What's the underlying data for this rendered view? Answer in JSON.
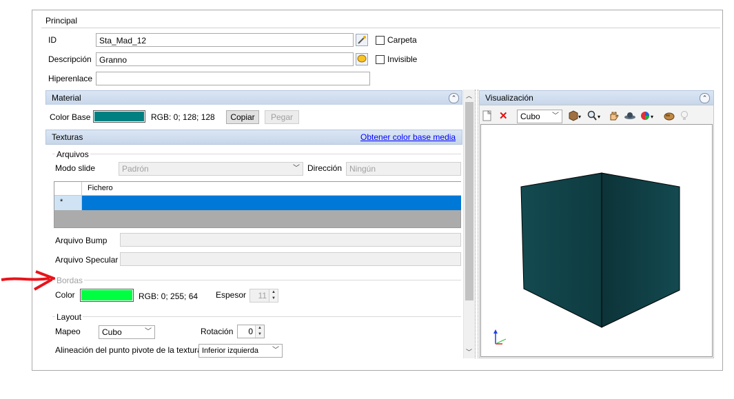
{
  "principal": {
    "header": "Principal"
  },
  "form": {
    "id_label": "ID",
    "id_value": "Sta_Mad_12",
    "desc_label": "Descripción",
    "desc_value": "Granno",
    "link_label": "Hiperenlace",
    "link_value": "",
    "carpeta_label": "Carpeta",
    "invisible_label": "Invisible"
  },
  "material": {
    "header": "Material",
    "color_base_label": "Color Base",
    "color_base_hex": "#008080",
    "rgb_text": "RGB: 0; 128; 128",
    "copy_label": "Copiar",
    "paste_label": "Pegar"
  },
  "texturas": {
    "header": "Texturas",
    "link": "Obtener color base media",
    "archivos_label": "Arquivos",
    "modo_label": "Modo slide",
    "modo_value": "Padrón",
    "direccion_label": "Dirección",
    "direccion_value": "Ningún",
    "grid_header": "Fichero",
    "grid_new_row_marker": "*",
    "bump_label": "Arquivo Bump",
    "specular_label": "Arquivo Specular"
  },
  "bordas": {
    "label": "Bordas",
    "color_label": "Color",
    "color_hex": "#00ff40",
    "rgb_text": "RGB: 0; 255; 64",
    "espesor_label": "Espesor",
    "espesor_value": "11"
  },
  "layout": {
    "label": "Layout",
    "mapeo_label": "Mapeo",
    "mapeo_value": "Cubo",
    "rotacion_label": "Rotación",
    "rotacion_value": "0",
    "pivote_label": "Alineación del punto pivote de la textura",
    "pivote_value": "Inferior izquierda"
  },
  "visualizacion": {
    "header": "Visualización",
    "shape_value": "Cubo",
    "cube_color": "#0f3f44"
  },
  "accent": {
    "annotation_arrow": "#e8141b",
    "selection": "#0078d7"
  }
}
